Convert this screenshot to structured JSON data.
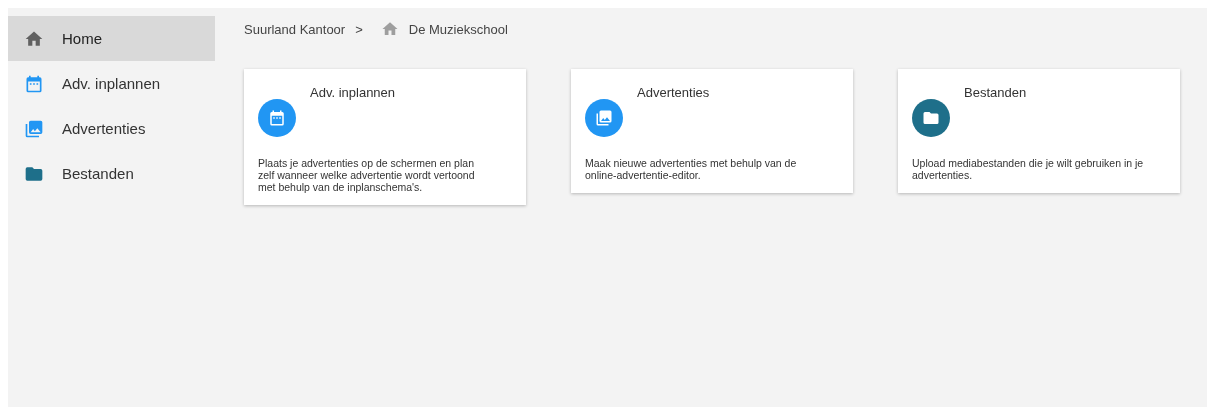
{
  "sidebar": {
    "items": [
      {
        "label": "Home",
        "kind": "home",
        "color": "#616161",
        "selected": true
      },
      {
        "label": "Adv. inplannen",
        "kind": "calendar",
        "color": "#2196f3",
        "selected": false
      },
      {
        "label": "Advertenties",
        "kind": "images",
        "color": "#2196f3",
        "selected": false
      },
      {
        "label": "Bestanden",
        "kind": "folder",
        "color": "#1e6f8a",
        "selected": false
      }
    ]
  },
  "breadcrumb": {
    "parent": "Suurland Kantoor",
    "separator": ">",
    "current": "De Muziekschool"
  },
  "cards": [
    {
      "title": "Adv. inplannen",
      "kind": "calendar",
      "color": "#2196f3",
      "description": "Plaats je advertenties op de schermen en plan zelf wanneer welke advertentie wordt vertoond met behulp van de inplanschema's."
    },
    {
      "title": "Advertenties",
      "kind": "images",
      "color": "#2196f3",
      "description": "Maak nieuwe advertenties met behulp van de online-advertentie-editor."
    },
    {
      "title": "Bestanden",
      "kind": "folder",
      "color": "#1e6f8a",
      "description": "Upload mediabestanden die je wilt gebruiken in je advertenties."
    }
  ]
}
